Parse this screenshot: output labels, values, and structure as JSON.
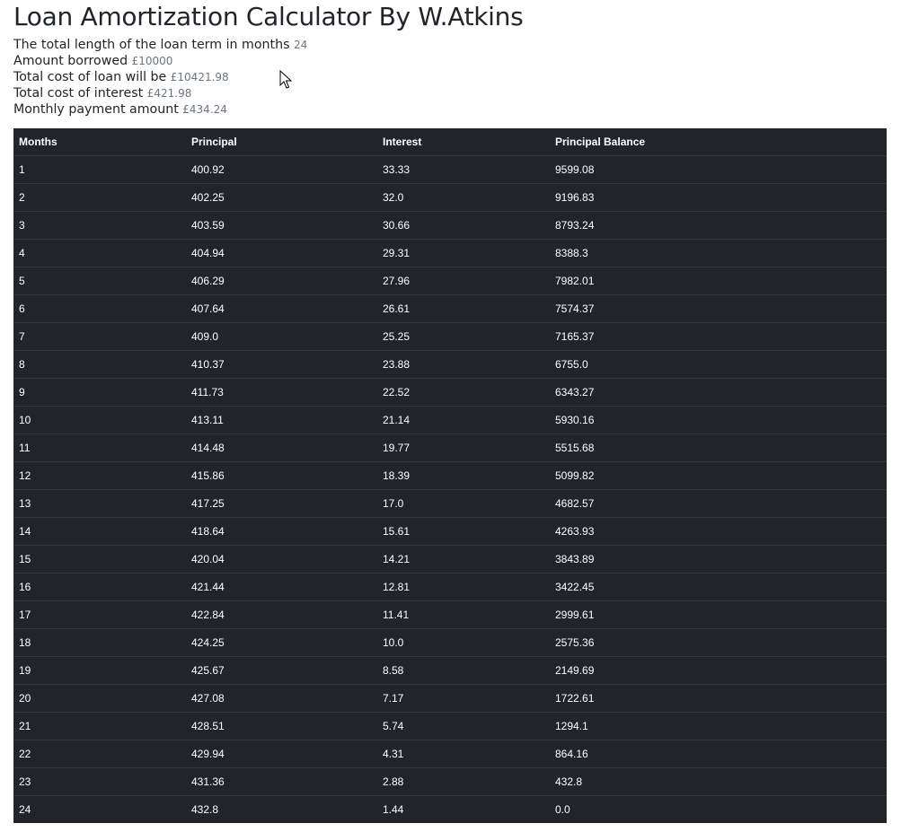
{
  "page": {
    "title": "Loan Amortization Calculator By W.Atkins"
  },
  "summary": {
    "term_label": "The total length of the loan term in months",
    "term_value": "24",
    "borrowed_label": "Amount borrowed",
    "borrowed_value": "£10000",
    "total_cost_label": "Total cost of loan will be",
    "total_cost_value": "£10421.98",
    "interest_label": "Total cost of interest",
    "interest_value": "£421.98",
    "monthly_label": "Monthly payment amount",
    "monthly_value": "£434.24"
  },
  "table": {
    "headers": [
      "Months",
      "Principal",
      "Interest",
      "Principal Balance"
    ],
    "rows": [
      [
        "1",
        "400.92",
        "33.33",
        "9599.08"
      ],
      [
        "2",
        "402.25",
        "32.0",
        "9196.83"
      ],
      [
        "3",
        "403.59",
        "30.66",
        "8793.24"
      ],
      [
        "4",
        "404.94",
        "29.31",
        "8388.3"
      ],
      [
        "5",
        "406.29",
        "27.96",
        "7982.01"
      ],
      [
        "6",
        "407.64",
        "26.61",
        "7574.37"
      ],
      [
        "7",
        "409.0",
        "25.25",
        "7165.37"
      ],
      [
        "8",
        "410.37",
        "23.88",
        "6755.0"
      ],
      [
        "9",
        "411.73",
        "22.52",
        "6343.27"
      ],
      [
        "10",
        "413.11",
        "21.14",
        "5930.16"
      ],
      [
        "11",
        "414.48",
        "19.77",
        "5515.68"
      ],
      [
        "12",
        "415.86",
        "18.39",
        "5099.82"
      ],
      [
        "13",
        "417.25",
        "17.0",
        "4682.57"
      ],
      [
        "14",
        "418.64",
        "15.61",
        "4263.93"
      ],
      [
        "15",
        "420.04",
        "14.21",
        "3843.89"
      ],
      [
        "16",
        "421.44",
        "12.81",
        "3422.45"
      ],
      [
        "17",
        "422.84",
        "11.41",
        "2999.61"
      ],
      [
        "18",
        "424.25",
        "10.0",
        "2575.36"
      ],
      [
        "19",
        "425.67",
        "8.58",
        "2149.69"
      ],
      [
        "20",
        "427.08",
        "7.17",
        "1722.61"
      ],
      [
        "21",
        "428.51",
        "5.74",
        "1294.1"
      ],
      [
        "22",
        "429.94",
        "4.31",
        "864.16"
      ],
      [
        "23",
        "431.36",
        "2.88",
        "432.8"
      ],
      [
        "24",
        "432.8",
        "1.44",
        "0.0"
      ]
    ]
  },
  "colors": {
    "table_bg": "#212529",
    "table_border": "#32383e",
    "muted_text": "#6c757d"
  },
  "icons": {
    "cursor": "mouse-pointer-icon"
  }
}
